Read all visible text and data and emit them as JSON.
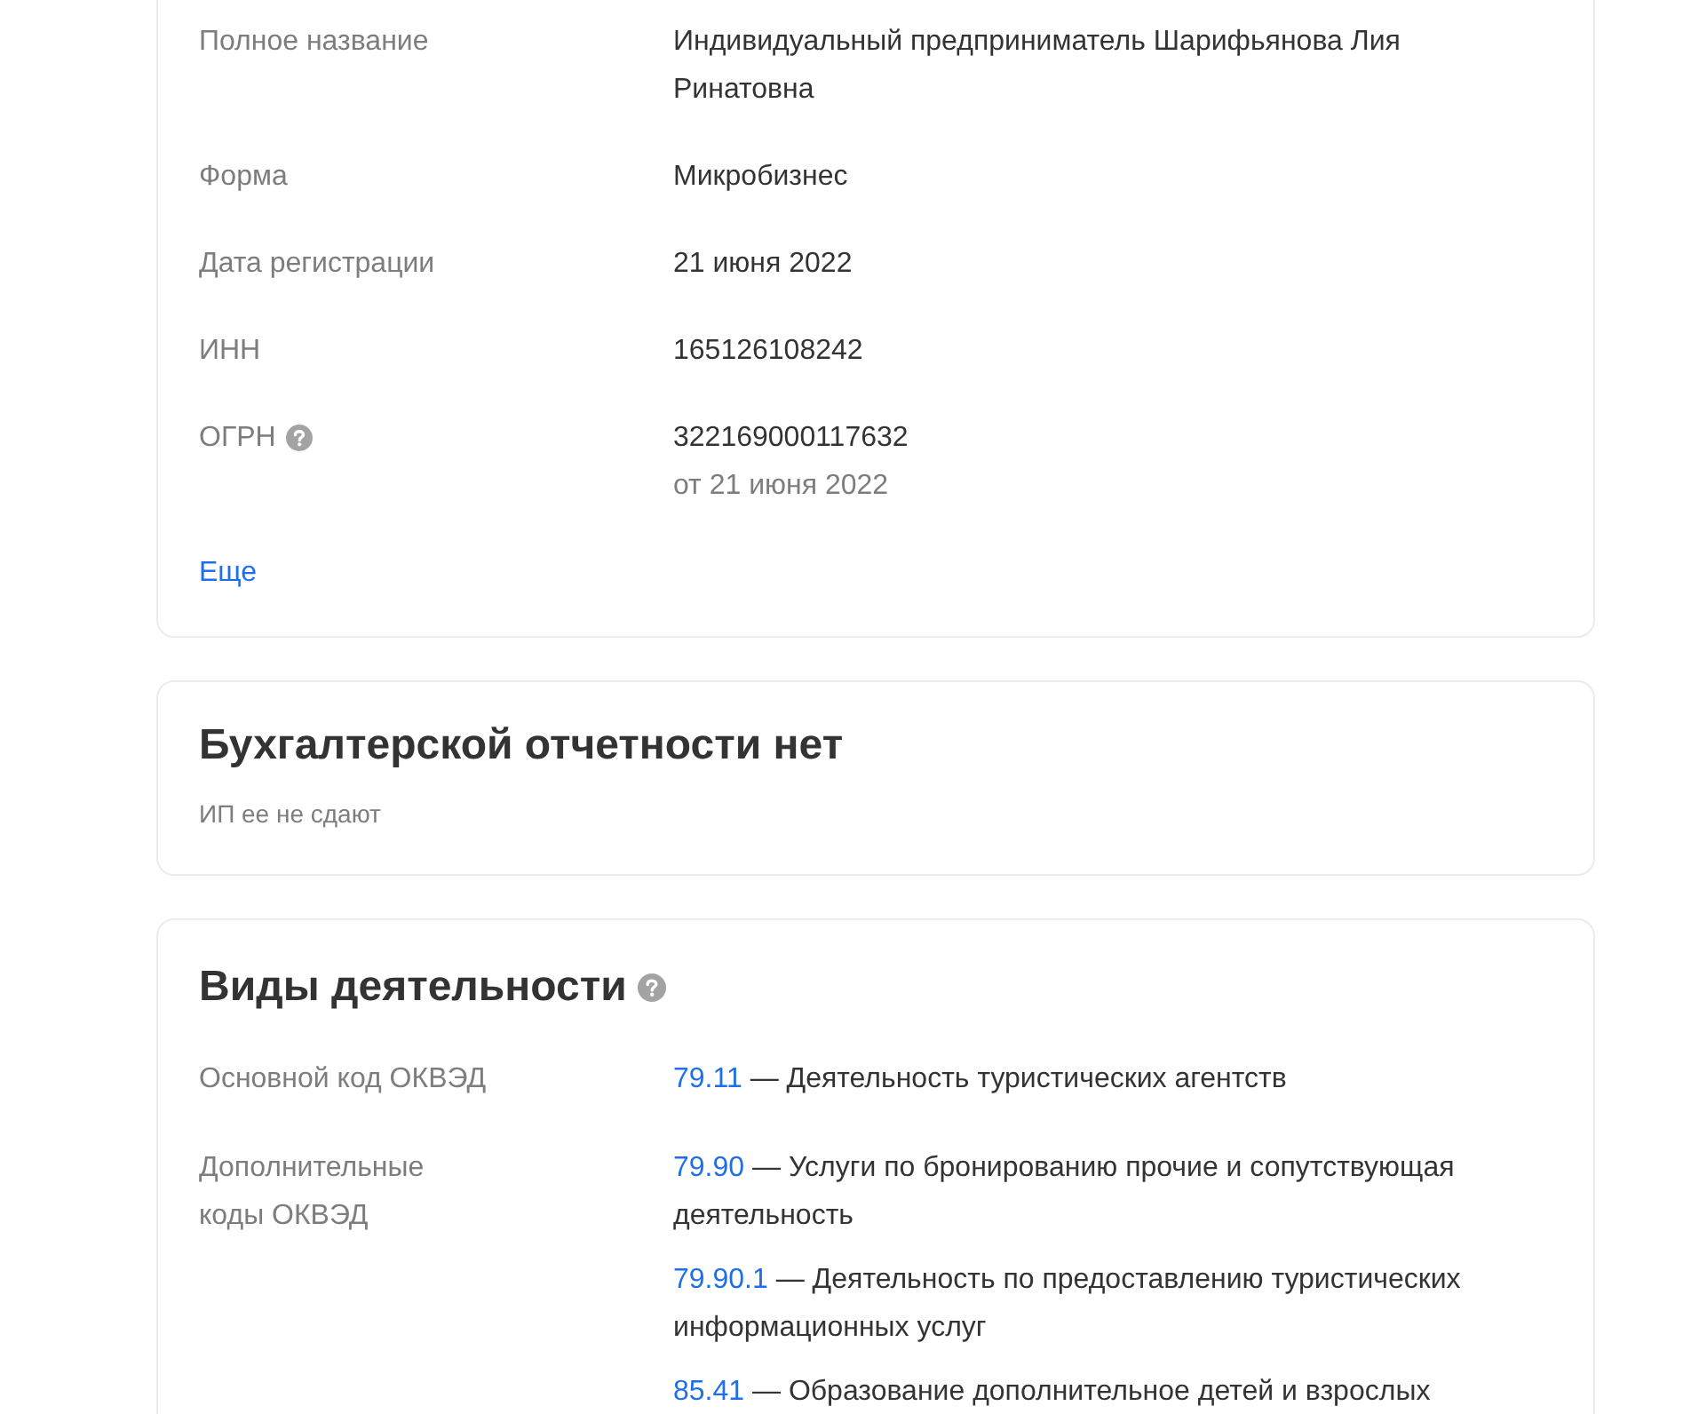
{
  "company_details": {
    "rows": [
      {
        "label": "Полное название",
        "value": "Индивидуальный предприниматель Шарифьянова Лия Ринатовна"
      },
      {
        "label": "Форма",
        "value": "Микробизнес"
      },
      {
        "label": "Дата регистрации",
        "value": "21 июня 2022"
      },
      {
        "label": "ИНН",
        "value": "165126108242"
      },
      {
        "label": "ОГРН",
        "help": true,
        "value": "322169000117632",
        "note": "от 21 июня 2022"
      }
    ],
    "more_link": "Еще"
  },
  "accounting": {
    "title": "Бухгалтерской отчетности нет",
    "subtitle": "ИП ее не сдают"
  },
  "activities": {
    "title": "Виды деятельности",
    "help": true,
    "rows": [
      {
        "label": "Основной код ОКВЭД",
        "entries": [
          {
            "code": "79.11",
            "description": "— Деятельность туристических агентств"
          }
        ]
      },
      {
        "label": "Дополнительные коды ОКВЭД",
        "entries": [
          {
            "code": "79.90",
            "description": "— Услуги по бронированию прочие и сопутствующая деятельность"
          },
          {
            "code": "79.90.1",
            "description": "— Деятельность по предоставлению туристических информационных услуг"
          },
          {
            "code": "85.41",
            "description": "— Образование дополнительное детей и взрослых"
          }
        ]
      }
    ]
  }
}
